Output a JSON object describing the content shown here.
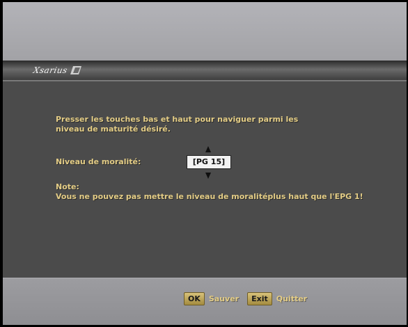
{
  "header": {
    "logo_text": "Xsarius"
  },
  "main": {
    "instructions_line1": "Presser les touches bas et haut pour naviguer parmi les",
    "instructions_line2": "niveau de maturité désiré.",
    "level_label": "Niveau de moralité:",
    "level_value": "[PG 15]",
    "note_title": "Note:",
    "note_text": "Vous ne pouvez pas mettre le niveau de moralitéplus haut que l'EPG 1!"
  },
  "footer": {
    "ok_key": "OK",
    "ok_label": "Sauver",
    "exit_key": "Exit",
    "exit_label": "Quitter"
  },
  "colors": {
    "text_gold": "#e4cd86",
    "panel_gray": "#4b4b4b",
    "band_gray": "#a4a4a8"
  }
}
